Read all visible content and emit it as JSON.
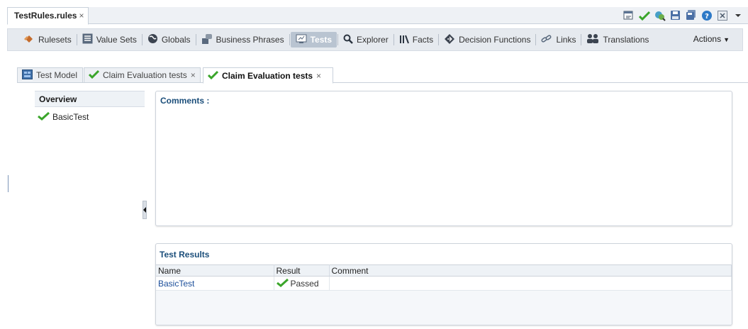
{
  "editor_tab": {
    "label": "TestRules.rules",
    "close": "×"
  },
  "toolbar_icons": [
    "validate-icon",
    "check-icon",
    "search-icon",
    "save-icon",
    "save-all-icon",
    "help-icon",
    "close-panel-icon",
    "dropdown-icon"
  ],
  "nav": {
    "items": [
      {
        "label": "Rulesets",
        "icon": "ruleset-icon"
      },
      {
        "label": "Value Sets",
        "icon": "value-sets-icon"
      },
      {
        "label": "Globals",
        "icon": "globals-icon"
      },
      {
        "label": "Business Phrases",
        "icon": "business-phrases-icon"
      },
      {
        "label": "Tests",
        "icon": "tests-icon",
        "active": true
      },
      {
        "label": "Explorer",
        "icon": "search-icon"
      },
      {
        "label": "Facts",
        "icon": "facts-icon"
      },
      {
        "label": "Decision Functions",
        "icon": "decision-functions-icon"
      },
      {
        "label": "Links",
        "icon": "links-icon"
      },
      {
        "label": "Translations",
        "icon": "translations-icon"
      }
    ],
    "actions_label": "Actions"
  },
  "subtabs": [
    {
      "label": "Test Model",
      "icon": "test-model-icon"
    },
    {
      "label": "Claim Evaluation tests",
      "icon": "check-icon",
      "close": "×"
    },
    {
      "label": "Claim Evaluation tests",
      "icon": "check-icon",
      "close": "×",
      "active": true
    }
  ],
  "overview": {
    "header": "Overview",
    "items": [
      {
        "label": "BasicTest",
        "icon": "check-icon"
      }
    ]
  },
  "comments": {
    "label": "Comments :"
  },
  "results": {
    "title": "Test Results",
    "columns": [
      "Name",
      "Result",
      "Comment"
    ],
    "rows": [
      {
        "name": "BasicTest",
        "result": "Passed",
        "comment": ""
      }
    ]
  },
  "colors": {
    "accent_blue": "#1b4e7a",
    "pass_green": "#3aa52a",
    "nav_active": "#b9c4d1"
  }
}
